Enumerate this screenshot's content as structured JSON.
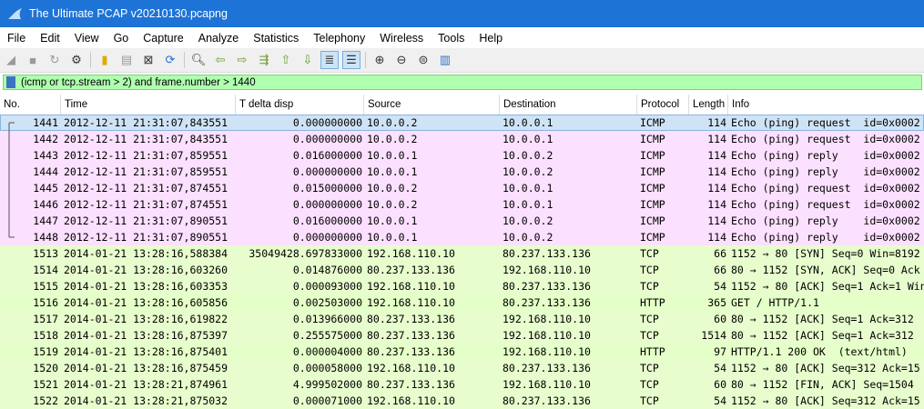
{
  "window": {
    "title": "The Ultimate PCAP v20210130.pcapng"
  },
  "menu": [
    "File",
    "Edit",
    "View",
    "Go",
    "Capture",
    "Analyze",
    "Statistics",
    "Telephony",
    "Wireless",
    "Tools",
    "Help"
  ],
  "filter": {
    "value": "(icmp or tcp.stream > 2) and frame.number > 1440"
  },
  "columns": [
    "No.",
    "Time",
    "T delta disp",
    "Source",
    "Destination",
    "Protocol",
    "Length",
    "Info"
  ],
  "colors": {
    "icmp": "#fce0ff",
    "tcp": "#e7fdcd",
    "http": "#e4ffc7",
    "selected": "#cfe3f6",
    "filter_ok": "#afffaf",
    "titlebar": "#1e73d6"
  },
  "packets": [
    {
      "no": "1441",
      "time": "2012-12-11 21:31:07,843551",
      "delta": "0.000000000",
      "src": "10.0.0.2",
      "dst": "10.0.0.1",
      "proto": "ICMP",
      "len": "114",
      "info": "Echo (ping) request  id=0x0002",
      "kind": "icmp",
      "selected": true
    },
    {
      "no": "1442",
      "time": "2012-12-11 21:31:07,843551",
      "delta": "0.000000000",
      "src": "10.0.0.2",
      "dst": "10.0.0.1",
      "proto": "ICMP",
      "len": "114",
      "info": "Echo (ping) request  id=0x0002",
      "kind": "icmp"
    },
    {
      "no": "1443",
      "time": "2012-12-11 21:31:07,859551",
      "delta": "0.016000000",
      "src": "10.0.0.1",
      "dst": "10.0.0.2",
      "proto": "ICMP",
      "len": "114",
      "info": "Echo (ping) reply    id=0x0002",
      "kind": "icmp"
    },
    {
      "no": "1444",
      "time": "2012-12-11 21:31:07,859551",
      "delta": "0.000000000",
      "src": "10.0.0.1",
      "dst": "10.0.0.2",
      "proto": "ICMP",
      "len": "114",
      "info": "Echo (ping) reply    id=0x0002",
      "kind": "icmp"
    },
    {
      "no": "1445",
      "time": "2012-12-11 21:31:07,874551",
      "delta": "0.015000000",
      "src": "10.0.0.2",
      "dst": "10.0.0.1",
      "proto": "ICMP",
      "len": "114",
      "info": "Echo (ping) request  id=0x0002",
      "kind": "icmp"
    },
    {
      "no": "1446",
      "time": "2012-12-11 21:31:07,874551",
      "delta": "0.000000000",
      "src": "10.0.0.2",
      "dst": "10.0.0.1",
      "proto": "ICMP",
      "len": "114",
      "info": "Echo (ping) request  id=0x0002",
      "kind": "icmp"
    },
    {
      "no": "1447",
      "time": "2012-12-11 21:31:07,890551",
      "delta": "0.016000000",
      "src": "10.0.0.1",
      "dst": "10.0.0.2",
      "proto": "ICMP",
      "len": "114",
      "info": "Echo (ping) reply    id=0x0002",
      "kind": "icmp"
    },
    {
      "no": "1448",
      "time": "2012-12-11 21:31:07,890551",
      "delta": "0.000000000",
      "src": "10.0.0.1",
      "dst": "10.0.0.2",
      "proto": "ICMP",
      "len": "114",
      "info": "Echo (ping) reply    id=0x0002",
      "kind": "icmp"
    },
    {
      "no": "1513",
      "time": "2014-01-21 13:28:16,588384",
      "delta": "35049428.697833000",
      "src": "192.168.110.10",
      "dst": "80.237.133.136",
      "proto": "TCP",
      "len": "66",
      "info": "1152 → 80 [SYN] Seq=0 Win=8192",
      "kind": "tcp"
    },
    {
      "no": "1514",
      "time": "2014-01-21 13:28:16,603260",
      "delta": "0.014876000",
      "src": "80.237.133.136",
      "dst": "192.168.110.10",
      "proto": "TCP",
      "len": "66",
      "info": "80 → 1152 [SYN, ACK] Seq=0 Ack",
      "kind": "tcp"
    },
    {
      "no": "1515",
      "time": "2014-01-21 13:28:16,603353",
      "delta": "0.000093000",
      "src": "192.168.110.10",
      "dst": "80.237.133.136",
      "proto": "TCP",
      "len": "54",
      "info": "1152 → 80 [ACK] Seq=1 Ack=1 Win",
      "kind": "tcp"
    },
    {
      "no": "1516",
      "time": "2014-01-21 13:28:16,605856",
      "delta": "0.002503000",
      "src": "192.168.110.10",
      "dst": "80.237.133.136",
      "proto": "HTTP",
      "len": "365",
      "info": "GET / HTTP/1.1",
      "kind": "http"
    },
    {
      "no": "1517",
      "time": "2014-01-21 13:28:16,619822",
      "delta": "0.013966000",
      "src": "80.237.133.136",
      "dst": "192.168.110.10",
      "proto": "TCP",
      "len": "60",
      "info": "80 → 1152 [ACK] Seq=1 Ack=312",
      "kind": "tcp"
    },
    {
      "no": "1518",
      "time": "2014-01-21 13:28:16,875397",
      "delta": "0.255575000",
      "src": "80.237.133.136",
      "dst": "192.168.110.10",
      "proto": "TCP",
      "len": "1514",
      "info": "80 → 1152 [ACK] Seq=1 Ack=312",
      "kind": "tcp"
    },
    {
      "no": "1519",
      "time": "2014-01-21 13:28:16,875401",
      "delta": "0.000004000",
      "src": "80.237.133.136",
      "dst": "192.168.110.10",
      "proto": "HTTP",
      "len": "97",
      "info": "HTTP/1.1 200 OK  (text/html)",
      "kind": "http"
    },
    {
      "no": "1520",
      "time": "2014-01-21 13:28:16,875459",
      "delta": "0.000058000",
      "src": "192.168.110.10",
      "dst": "80.237.133.136",
      "proto": "TCP",
      "len": "54",
      "info": "1152 → 80 [ACK] Seq=312 Ack=15",
      "kind": "tcp"
    },
    {
      "no": "1521",
      "time": "2014-01-21 13:28:21,874961",
      "delta": "4.999502000",
      "src": "80.237.133.136",
      "dst": "192.168.110.10",
      "proto": "TCP",
      "len": "60",
      "info": "80 → 1152 [FIN, ACK] Seq=1504",
      "kind": "tcp"
    },
    {
      "no": "1522",
      "time": "2014-01-21 13:28:21,875032",
      "delta": "0.000071000",
      "src": "192.168.110.10",
      "dst": "80.237.133.136",
      "proto": "TCP",
      "len": "54",
      "info": "1152 → 80 [ACK] Seq=312 Ack=15",
      "kind": "tcp"
    }
  ]
}
